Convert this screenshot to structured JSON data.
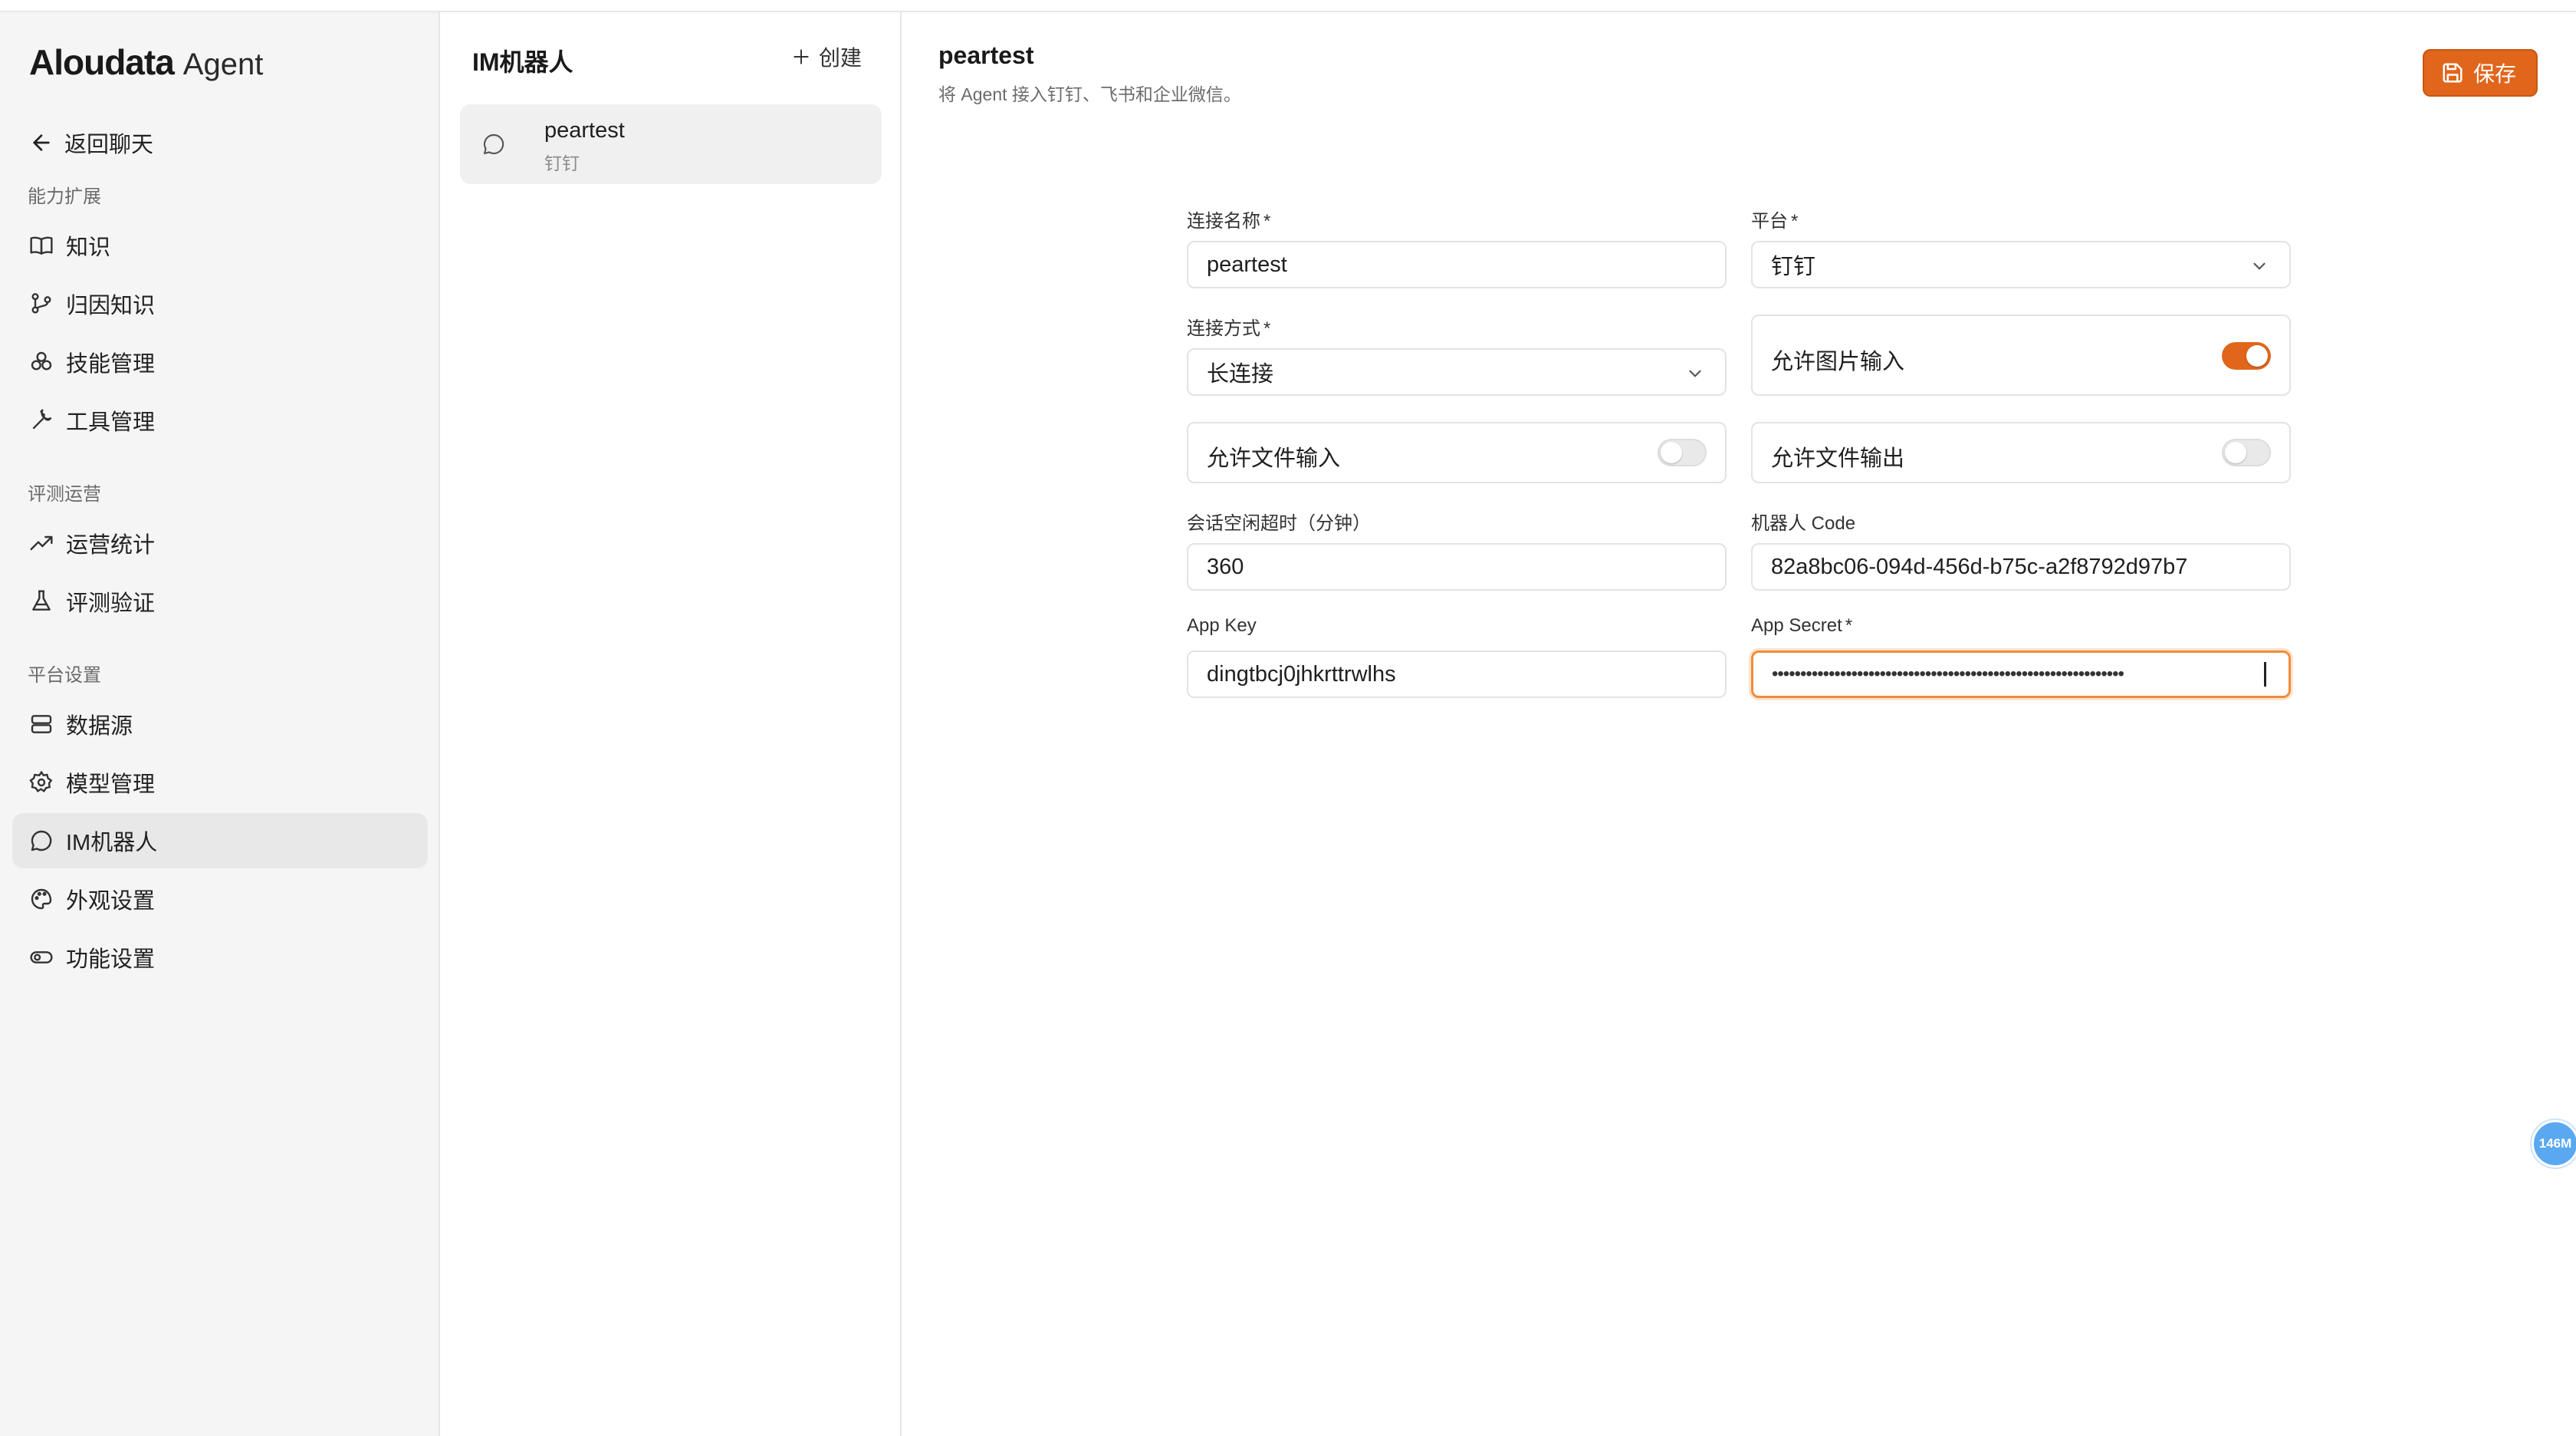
{
  "sidebar": {
    "brand": "Aloudata",
    "brand_sub": "Agent",
    "back_label": "返回聊天",
    "sections": [
      {
        "title": "能力扩展",
        "items": [
          {
            "label": "知识",
            "icon": "book-icon"
          },
          {
            "label": "归因知识",
            "icon": "git-branch-icon"
          },
          {
            "label": "技能管理",
            "icon": "skills-icon"
          },
          {
            "label": "工具管理",
            "icon": "wrench-icon"
          }
        ]
      },
      {
        "title": "评测运营",
        "items": [
          {
            "label": "运营统计",
            "icon": "trending-up-icon"
          },
          {
            "label": "评测验证",
            "icon": "flask-icon"
          }
        ]
      },
      {
        "title": "平台设置",
        "items": [
          {
            "label": "数据源",
            "icon": "database-icon"
          },
          {
            "label": "模型管理",
            "icon": "gear-icon"
          },
          {
            "label": "IM机器人",
            "icon": "chat-icon",
            "active": true
          },
          {
            "label": "外观设置",
            "icon": "palette-icon"
          },
          {
            "label": "功能设置",
            "icon": "toggle-icon"
          }
        ]
      }
    ]
  },
  "middle": {
    "title": "IM机器人",
    "create_label": "创建",
    "items": [
      {
        "name": "peartest",
        "platform": "钉钉"
      }
    ]
  },
  "main": {
    "title": "peartest",
    "description": "将 Agent 接入钉钉、飞书和企业微信。",
    "save_label": "保存",
    "form": {
      "name_label": "连接名称",
      "name_value": "peartest",
      "platform_label": "平台",
      "platform_value": "钉钉",
      "mode_label": "连接方式",
      "mode_value": "长连接",
      "allow_image_input": {
        "label": "允许图片输入",
        "enabled": true
      },
      "allow_file_input": {
        "label": "允许文件输入",
        "enabled": false
      },
      "allow_file_output": {
        "label": "允许文件输出",
        "enabled": false
      },
      "timeout_label": "会话空闲超时（分钟）",
      "timeout_value": "360",
      "robot_code_label": "机器人 Code",
      "robot_code_value": "82a8bc06-094d-456d-b75c-a2f8792d97b7",
      "app_key_label": "App Key",
      "app_key_value": "dingtbcj0jhkrttrwlhs",
      "app_secret_label": "App Secret",
      "app_secret_value": "••••••••••••••••••••••••••••••••••••••••••••••••••••••••••••••"
    },
    "required_mark": "*"
  },
  "memory_badge": "146M",
  "colors": {
    "accent": "#e0661c",
    "badge": "#5aa9f0"
  }
}
